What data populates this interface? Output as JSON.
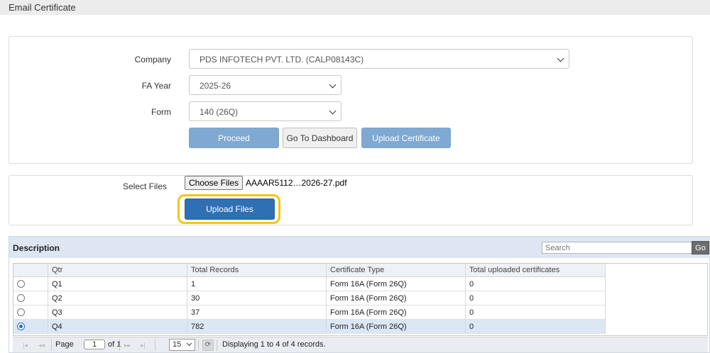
{
  "page": {
    "title": "Email Certificate"
  },
  "form": {
    "company_label": "Company",
    "company_value": "PDS INFOTECH PVT. LTD. (CALP08143C)",
    "fa_year_label": "FA Year",
    "fa_year_value": "2025-26",
    "form_label": "Form",
    "form_value": "140 (26Q)",
    "proceed_label": "Proceed",
    "dashboard_label": "Go To Dashboard",
    "upload_certificate_label": "Upload Certificate"
  },
  "upload": {
    "select_files_label": "Select Files",
    "choose_files_label": "Choose Files",
    "selected_file": "AAAAR5112…2026-27.pdf",
    "upload_files_label": "Upload Files",
    "highlight_color": "#f5c518"
  },
  "grid": {
    "title": "Description",
    "search_placeholder": "Search",
    "go_label": "Go",
    "columns": [
      "Qtr",
      "Total Records",
      "Certificate Type",
      "Total uploaded certificates"
    ],
    "rows": [
      {
        "qtr": "Q1",
        "total": "1",
        "type": "Form 16A (Form 26Q)",
        "uploaded": "0",
        "selected": false
      },
      {
        "qtr": "Q2",
        "total": "30",
        "type": "Form 16A (Form 26Q)",
        "uploaded": "0",
        "selected": false
      },
      {
        "qtr": "Q3",
        "total": "37",
        "type": "Form 16A (Form 26Q)",
        "uploaded": "0",
        "selected": false
      },
      {
        "qtr": "Q4",
        "total": "782",
        "type": "Form 16A (Form 26Q)",
        "uploaded": "0",
        "selected": true
      }
    ],
    "pager": {
      "page_label": "Page",
      "page_value": "1",
      "of_label": "of 1",
      "page_size": "15",
      "status": "Displaying 1 to 4 of 4 records."
    }
  },
  "icons": {
    "first": "first-page-icon",
    "prev": "prev-page-icon",
    "next": "next-page-icon",
    "last": "last-page-icon",
    "refresh": "refresh-icon"
  }
}
